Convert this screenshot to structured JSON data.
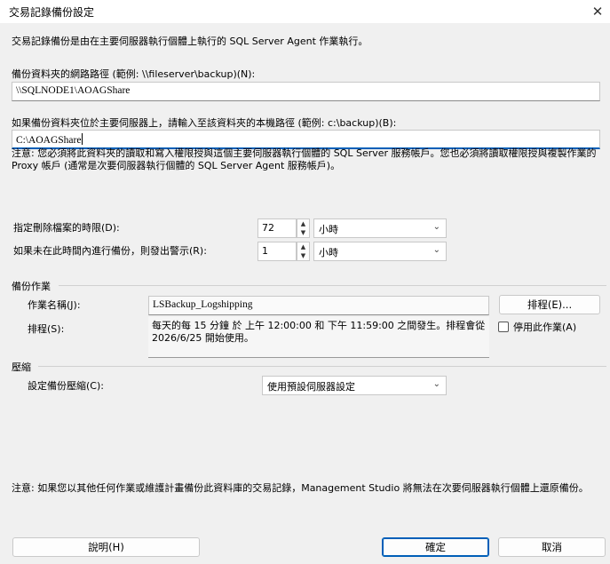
{
  "window": {
    "title": "交易記錄備份設定",
    "close_glyph": "✕"
  },
  "intro": "交易記錄備份是由在主要伺服器執行個體上執行的 SQL Server Agent 作業執行。",
  "network_path": {
    "label": "備份資料夾的網路路徑 (範例: \\\\fileserver\\backup)(N):",
    "value": "\\\\SQLNODE1\\AOAGShare"
  },
  "local_path": {
    "label": "如果備份資料夾位於主要伺服器上，請輸入至該資料夾的本機路徑 (範例: c:\\backup)(B):",
    "value": "C:\\AOAGShare"
  },
  "permission_note": "注意: 您必須將此資料夾的讀取和寫入權限授與這個主要伺服器執行個體的 SQL Server 服務帳戶。您也必須將讀取權限授與複製作業的 Proxy 帳戶 (通常是次要伺服器執行個體的 SQL Server Agent 服務帳戶)。",
  "delete_files": {
    "label": "指定刪除檔案的時限(D):",
    "value": "72",
    "unit": "小時"
  },
  "alert": {
    "label": "如果未在此時間內進行備份，則發出警示(R):",
    "value": "1",
    "unit": "小時"
  },
  "backup_job": {
    "group_title": "備份作業",
    "job_name_label": "作業名稱(J):",
    "job_name": "LSBackup_Logshipping",
    "schedule_button": "排程(E)...",
    "schedule_label": "排程(S):",
    "schedule_text": "每天的每 15 分鐘 於 上午 12:00:00 和 下午 11:59:00 之間發生。排程會從 2026/6/25 開始使用。",
    "disable_label": "停用此作業(A)"
  },
  "compression": {
    "group_title": "壓縮",
    "label": "設定備份壓縮(C):",
    "value": "使用預設伺服器設定"
  },
  "bottom_note": "注意: 如果您以其他任何作業或維護計畫備份此資料庫的交易記錄，Management Studio 將無法在次要伺服器執行個體上還原備份。",
  "buttons": {
    "help": "說明(H)",
    "ok": "確定",
    "cancel": "取消"
  },
  "icons": {
    "spin_up": "▲",
    "spin_down": "▼",
    "dropdown": "⌄"
  }
}
